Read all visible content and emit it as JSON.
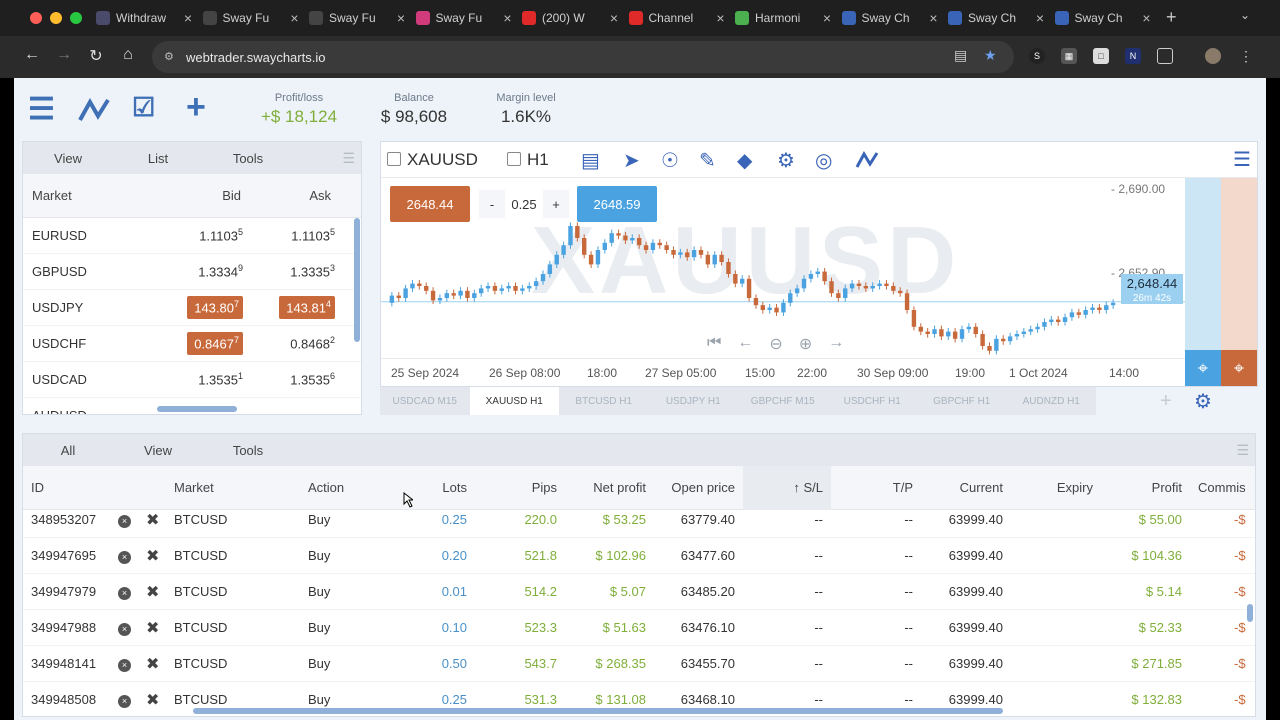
{
  "browser": {
    "tabs": [
      {
        "title": "Withdraw",
        "icon": "sway-s-icon",
        "color": "#4a4a6a"
      },
      {
        "title": "Sway Fu",
        "icon": "sway-f-icon",
        "color": "#444"
      },
      {
        "title": "Sway Fu",
        "icon": "sway-f-icon",
        "color": "#444"
      },
      {
        "title": "Sway Fu",
        "icon": "instagram-icon",
        "color": "#d13b7c"
      },
      {
        "title": "(200) W",
        "icon": "youtube-icon",
        "color": "#e02a2a"
      },
      {
        "title": "Channel",
        "icon": "youtube-icon",
        "color": "#e02a2a"
      },
      {
        "title": "Harmoni",
        "icon": "gear-icon",
        "color": "#4caf50"
      },
      {
        "title": "Sway Ch",
        "icon": "sway-logo-icon",
        "color": "#3a64b8"
      },
      {
        "title": "Sway Ch",
        "icon": "sway-logo-icon",
        "color": "#3a64b8"
      },
      {
        "title": "Sway Ch",
        "icon": "sway-logo-icon",
        "color": "#3a64b8"
      }
    ],
    "url": "webtrader.swaycharts.io"
  },
  "header": {
    "profit_loss_label": "Profit/loss",
    "profit_loss_value": "+$ 18,124",
    "balance_label": "Balance",
    "balance_value": "$ 98,608",
    "margin_label": "Margin level",
    "margin_value": "1.6K%"
  },
  "market_panel": {
    "tabs": [
      "View",
      "List",
      "Tools"
    ],
    "columns": [
      "Market",
      "Bid",
      "Ask"
    ],
    "rows": [
      {
        "market": "EURUSD",
        "bid": "1.1103",
        "bid_sup": "5",
        "ask": "1.1103",
        "ask_sup": "5",
        "bid_hl": false,
        "ask_hl": false
      },
      {
        "market": "GBPUSD",
        "bid": "1.3334",
        "bid_sup": "9",
        "ask": "1.3335",
        "ask_sup": "3",
        "bid_hl": false,
        "ask_hl": false
      },
      {
        "market": "USDJPY",
        "bid": "143.80",
        "bid_sup": "7",
        "ask": "143.81",
        "ask_sup": "4",
        "bid_hl": true,
        "ask_hl": true
      },
      {
        "market": "USDCHF",
        "bid": "0.8467",
        "bid_sup": "7",
        "ask": "0.8468",
        "ask_sup": "2",
        "bid_hl": true,
        "ask_hl": false
      },
      {
        "market": "USDCAD",
        "bid": "1.3535",
        "bid_sup": "1",
        "ask": "1.3535",
        "ask_sup": "6",
        "bid_hl": false,
        "ask_hl": false
      },
      {
        "market": "AUDUSD",
        "bid": "",
        "bid_sup": "",
        "ask": "",
        "ask_sup": "",
        "bid_hl": true,
        "ask_hl": true
      }
    ]
  },
  "chart": {
    "symbol": "XAUUSD",
    "timeframe": "H1",
    "watermark": "XAUUSD",
    "sell_price": "2648.44",
    "buy_price": "2648.59",
    "lot_minus": "-",
    "lot_value": "0.25",
    "lot_plus": "+",
    "current_price": "2,648.44",
    "countdown": "26m 42s",
    "price_ticks": [
      "- 2,690.00",
      "- 2,652.90"
    ],
    "x_ticks": [
      "25 Sep 2024",
      "26 Sep 08:00",
      "18:00",
      "27 Sep 05:00",
      "15:00",
      "22:00",
      "30 Sep 09:00",
      "19:00",
      "1 Oct 2024",
      "14:00"
    ],
    "symbol_tabs": [
      "USDCAD M15",
      "XAUUSD H1",
      "BTCUSD H1",
      "USDJPY H1",
      "GBPCHF M15",
      "USDCHF H1",
      "GBPCHF H1",
      "AUDNZD H1"
    ],
    "up_color": "#4aa3e0",
    "down_color": "#c8693b"
  },
  "chart_data": {
    "type": "candlestick",
    "symbol": "XAUUSD",
    "timeframe": "H1",
    "ylim": [
      2625,
      2700
    ],
    "closes": [
      2648,
      2651,
      2650,
      2654,
      2656,
      2655,
      2653,
      2649,
      2650,
      2652,
      2651,
      2653,
      2650,
      2652,
      2654,
      2655,
      2653,
      2654,
      2655,
      2653,
      2654,
      2655,
      2657,
      2660,
      2664,
      2668,
      2672,
      2680,
      2675,
      2668,
      2664,
      2670,
      2673,
      2677,
      2676,
      2674,
      2675,
      2672,
      2670,
      2673,
      2672,
      2670,
      2668,
      2669,
      2667,
      2670,
      2668,
      2664,
      2668,
      2665,
      2660,
      2656,
      2658,
      2650,
      2647,
      2645,
      2646,
      2644,
      2648,
      2652,
      2654,
      2658,
      2660,
      2661,
      2657,
      2652,
      2650,
      2654,
      2656,
      2655,
      2654,
      2655,
      2656,
      2655,
      2653,
      2652,
      2645,
      2638,
      2636,
      2635,
      2637,
      2634,
      2636,
      2633,
      2637,
      2638,
      2635,
      2630,
      2628,
      2633,
      2632,
      2634,
      2635,
      2636,
      2637,
      2638,
      2640,
      2641,
      2640,
      2642,
      2644,
      2643,
      2645,
      2646,
      2645,
      2647,
      2648
    ]
  },
  "orders": {
    "tabs": [
      "All",
      "View",
      "Tools"
    ],
    "columns": [
      "ID",
      "Market",
      "Action",
      "Lots",
      "Pips",
      "Net profit",
      "Open price",
      "S/L",
      "T/P",
      "Current",
      "Expiry",
      "Profit",
      "Commis"
    ],
    "rows": [
      {
        "id": "348953207",
        "market": "BTCUSD",
        "action": "Buy",
        "lots": "0.25",
        "pips": "220.0",
        "net": "$ 53.25",
        "open": "63779.40",
        "sl": "--",
        "tp": "--",
        "current": "63999.40",
        "expiry": "",
        "profit": "$ 55.00",
        "comm": "-$"
      },
      {
        "id": "349947695",
        "market": "BTCUSD",
        "action": "Buy",
        "lots": "0.20",
        "pips": "521.8",
        "net": "$ 102.96",
        "open": "63477.60",
        "sl": "--",
        "tp": "--",
        "current": "63999.40",
        "expiry": "",
        "profit": "$ 104.36",
        "comm": "-$"
      },
      {
        "id": "349947979",
        "market": "BTCUSD",
        "action": "Buy",
        "lots": "0.01",
        "pips": "514.2",
        "net": "$ 5.07",
        "open": "63485.20",
        "sl": "--",
        "tp": "--",
        "current": "63999.40",
        "expiry": "",
        "profit": "$ 5.14",
        "comm": "-$"
      },
      {
        "id": "349947988",
        "market": "BTCUSD",
        "action": "Buy",
        "lots": "0.10",
        "pips": "523.3",
        "net": "$ 51.63",
        "open": "63476.10",
        "sl": "--",
        "tp": "--",
        "current": "63999.40",
        "expiry": "",
        "profit": "$ 52.33",
        "comm": "-$"
      },
      {
        "id": "349948141",
        "market": "BTCUSD",
        "action": "Buy",
        "lots": "0.50",
        "pips": "543.7",
        "net": "$ 268.35",
        "open": "63455.70",
        "sl": "--",
        "tp": "--",
        "current": "63999.40",
        "expiry": "",
        "profit": "$ 271.85",
        "comm": "-$"
      },
      {
        "id": "349948508",
        "market": "BTCUSD",
        "action": "Buy",
        "lots": "0.25",
        "pips": "531.3",
        "net": "$ 131.08",
        "open": "63468.10",
        "sl": "--",
        "tp": "--",
        "current": "63999.40",
        "expiry": "",
        "profit": "$ 132.83",
        "comm": "-$"
      }
    ]
  }
}
